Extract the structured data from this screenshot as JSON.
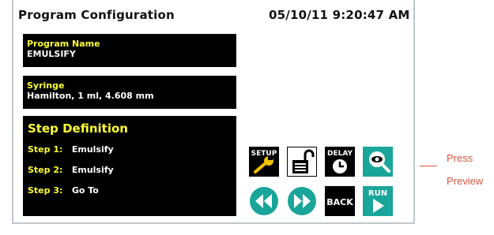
{
  "header": {
    "title": "Program Configuration",
    "datetime": "05/10/11  9:20:47 AM"
  },
  "program": {
    "label": "Program Name",
    "value": "EMULSIFY"
  },
  "syringe": {
    "label": "Syringe",
    "value": "Hamilton, 1 ml, 4.608 mm"
  },
  "steps": {
    "title": "Step Definition",
    "items": [
      {
        "label": "Step 1:",
        "value": "Emulsify"
      },
      {
        "label": "Step 2:",
        "value": "Emulsify"
      },
      {
        "label": "Step 3:",
        "value": "Go To"
      }
    ]
  },
  "buttons": {
    "setup": "SETUP",
    "delay": "DELAY",
    "back": "BACK",
    "run": "RUN"
  },
  "callout": {
    "line1": "Press",
    "line2": "Preview"
  },
  "colors": {
    "accent_teal": "#1aa59a",
    "label_yellow": "#ffff33",
    "callout": "#d9553c"
  }
}
